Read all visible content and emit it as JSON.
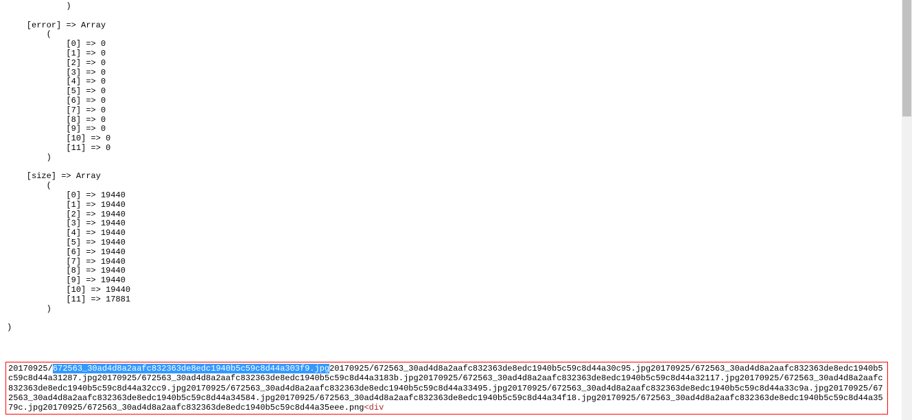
{
  "dump": {
    "lines": [
      "            )",
      "",
      "    [error] => Array",
      "        (",
      "            [0] => 0",
      "            [1] => 0",
      "            [2] => 0",
      "            [3] => 0",
      "            [4] => 0",
      "            [5] => 0",
      "            [6] => 0",
      "            [7] => 0",
      "            [8] => 0",
      "            [9] => 0",
      "            [10] => 0",
      "            [11] => 0",
      "        )",
      "",
      "    [size] => Array",
      "        (",
      "            [0] => 19440",
      "            [1] => 19440",
      "            [2] => 19440",
      "            [3] => 19440",
      "            [4] => 19440",
      "            [5] => 19440",
      "            [6] => 19440",
      "            [7] => 19440",
      "            [8] => 19440",
      "            [9] => 19440",
      "            [10] => 19440",
      "            [11] => 17881",
      "        )",
      "",
      ")"
    ]
  },
  "output": {
    "prefix_date": "20170925/",
    "highlight": "672563_30ad4d8a2aafc832363de8edc1940b5c59c8d44a303f9.jpg",
    "rest": "20170925/672563_30ad4d8a2aafc832363de8edc1940b5c59c8d44a30c95.jpg20170925/672563_30ad4d8a2aafc832363de8edc1940b5c59c8d44a31287.jpg20170925/672563_30ad4d8a2aafc832363de8edc1940b5c59c8d44a3183b.jpg20170925/672563_30ad4d8a2aafc832363de8edc1940b5c59c8d44a32117.jpg20170925/672563_30ad4d8a2aafc832363de8edc1940b5c59c8d44a32cc9.jpg20170925/672563_30ad4d8a2aafc832363de8edc1940b5c59c8d44a33495.jpg20170925/672563_30ad4d8a2aafc832363de8edc1940b5c59c8d44a33c9a.jpg20170925/672563_30ad4d8a2aafc832363de8edc1940b5c59c8d44a34584.jpg20170925/672563_30ad4d8a2aafc832363de8edc1940b5c59c8d44a34f18.jpg20170925/672563_30ad4d8a2aafc832363de8edc1940b5c59c8d44a3579c.jpg20170925/672563_30ad4d8a2aafc832363de8edc1940b5c59c8d44a35eee.png",
    "divtag": "<div"
  }
}
